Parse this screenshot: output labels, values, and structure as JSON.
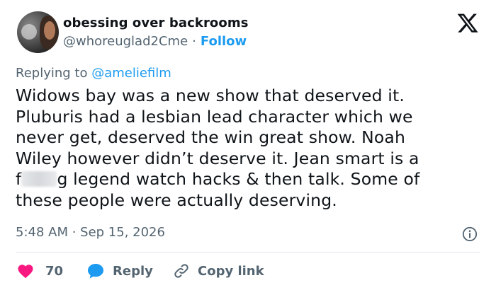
{
  "author": {
    "display_name": "obessing over backrooms",
    "handle": "@whoreuglad2Cme",
    "separator": "·",
    "follow_label": "Follow"
  },
  "reply_context": {
    "prefix": "Replying to",
    "mention": "@ameliefilm"
  },
  "tweet": {
    "lines": [
      "Widows bay was a new show that deserved it.",
      "Pluburis had a lesbian lead character which we",
      "never get, deserved the win great show. Noah",
      "Wiley however didn’t deserve it. Jean smart is a"
    ],
    "line5_start": "f",
    "line5_end": "g legend watch hacks & then talk. Some of",
    "line6": "these people were actually deserving."
  },
  "meta": {
    "timestamp": "5:48 AM · Sep 15, 2026"
  },
  "actions": {
    "like_count": "70",
    "reply_label": "Reply",
    "copy_link_label": "Copy link"
  },
  "colors": {
    "accent": "#1d9bf0",
    "like": "#f91880",
    "muted_text": "#536471",
    "text": "#0f1419"
  },
  "icons": {
    "brand": "x-logo-icon",
    "info": "info-icon",
    "like": "heart-icon",
    "reply": "speech-bubble-icon",
    "copy_link": "link-icon"
  }
}
